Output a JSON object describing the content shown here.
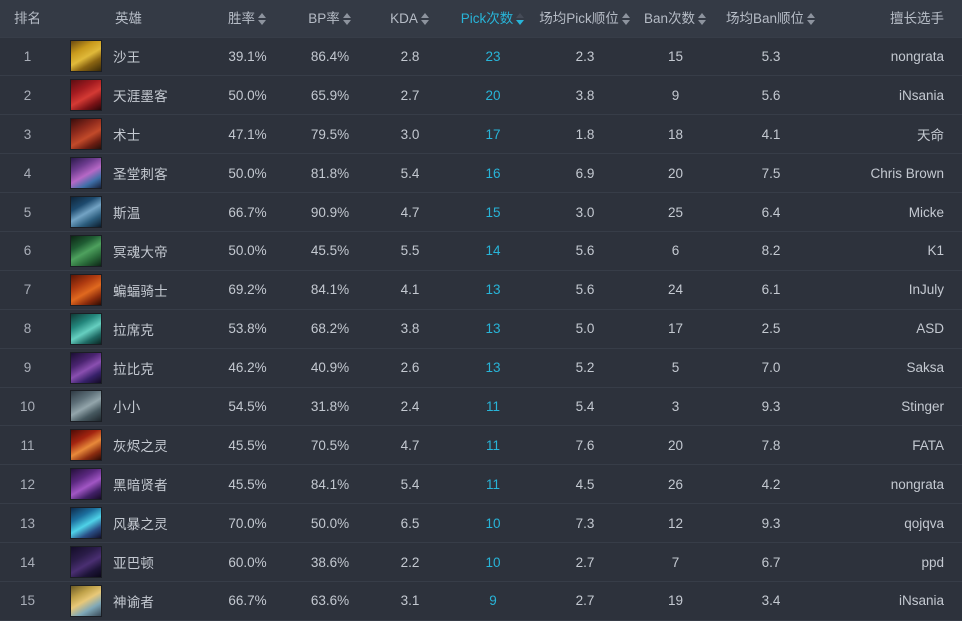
{
  "table": {
    "columns": [
      {
        "key": "rank",
        "label": "排名",
        "sortable": false,
        "active": false
      },
      {
        "key": "hero",
        "label": "英雄",
        "sortable": false,
        "active": false
      },
      {
        "key": "winrate",
        "label": "胜率",
        "sortable": true,
        "active": false
      },
      {
        "key": "bprate",
        "label": "BP率",
        "sortable": true,
        "active": false
      },
      {
        "key": "kda",
        "label": "KDA",
        "sortable": true,
        "active": false
      },
      {
        "key": "pickcnt",
        "label": "Pick次数",
        "sortable": true,
        "active": true
      },
      {
        "key": "avgpick",
        "label": "场均Pick顺位",
        "sortable": true,
        "active": false
      },
      {
        "key": "bancnt",
        "label": "Ban次数",
        "sortable": true,
        "active": false
      },
      {
        "key": "avgban",
        "label": "场均Ban顺位",
        "sortable": true,
        "active": false
      },
      {
        "key": "player",
        "label": "擅长选手",
        "sortable": false,
        "active": false
      }
    ],
    "sort": {
      "column": "pickcnt",
      "direction": "desc"
    },
    "colors": {
      "accent": "#28b4d8",
      "header_bg": "#343a45",
      "row_bg": "#2d323c",
      "row_border": "#373d48",
      "text": "#c4c9d1",
      "header_text": "#b6bcc6"
    },
    "rows": [
      {
        "rank": "1",
        "hero": "沙王",
        "hero_icon": "hero-portrait-sand-king",
        "portrait": "linear-gradient(150deg,#6b4a10 0%,#c99a1c 30%,#e0b93a 52%,#8a6412 72%,#3a2a07 100%)",
        "winrate": "39.1%",
        "bprate": "86.4%",
        "kda": "2.8",
        "pickcnt": "23",
        "avgpick": "2.3",
        "bancnt": "15",
        "avgban": "5.3",
        "player": "nongrata"
      },
      {
        "rank": "2",
        "hero": "天涯墨客",
        "hero_icon": "hero-portrait-grimstroke",
        "portrait": "linear-gradient(150deg,#5c0d12 0%,#a31b20 32%,#d43a34 55%,#7a1216 78%,#2a0608 100%)",
        "winrate": "50.0%",
        "bprate": "65.9%",
        "kda": "2.7",
        "pickcnt": "20",
        "avgpick": "3.8",
        "bancnt": "9",
        "avgban": "5.6",
        "player": "iNsania"
      },
      {
        "rank": "3",
        "hero": "术士",
        "hero_icon": "hero-portrait-warlock",
        "portrait": "linear-gradient(150deg,#3a0d0c 0%,#8e2a1c 34%,#c24a2a 58%,#6b1d12 80%,#24100a 100%)",
        "winrate": "47.1%",
        "bprate": "79.5%",
        "kda": "3.0",
        "pickcnt": "17",
        "avgpick": "1.8",
        "bancnt": "18",
        "avgban": "4.1",
        "player": "天命"
      },
      {
        "rank": "4",
        "hero": "圣堂刺客",
        "hero_icon": "hero-portrait-templar-assassin",
        "portrait": "linear-gradient(150deg,#2a1a4a 0%,#6d3c8f 30%,#b668c6 54%,#3f6fa8 76%,#17203a 100%)",
        "winrate": "50.0%",
        "bprate": "81.8%",
        "kda": "5.4",
        "pickcnt": "16",
        "avgpick": "6.9",
        "bancnt": "20",
        "avgban": "7.5",
        "player": "Chris Brown"
      },
      {
        "rank": "5",
        "hero": "斯温",
        "hero_icon": "hero-portrait-sven",
        "portrait": "linear-gradient(150deg,#0e2438 0%,#1d4a6e 30%,#73a3c4 52%,#2d5e7e 74%,#0b1b2a 100%)",
        "winrate": "66.7%",
        "bprate": "90.9%",
        "kda": "4.7",
        "pickcnt": "15",
        "avgpick": "3.0",
        "bancnt": "25",
        "avgban": "6.4",
        "player": "Micke"
      },
      {
        "rank": "6",
        "hero": "冥魂大帝",
        "hero_icon": "hero-portrait-wraith-king",
        "portrait": "linear-gradient(150deg,#0c2414 0%,#1f5c33 30%,#4ea15e 52%,#2a6b3a 74%,#0d2416 100%)",
        "winrate": "50.0%",
        "bprate": "45.5%",
        "kda": "5.5",
        "pickcnt": "14",
        "avgpick": "5.6",
        "bancnt": "6",
        "avgban": "8.2",
        "player": "K1"
      },
      {
        "rank": "7",
        "hero": "蝙蝠骑士",
        "hero_icon": "hero-portrait-batrider",
        "portrait": "linear-gradient(150deg,#5a1506 0%,#ae3a10 32%,#e0691f 56%,#8c2c0c 78%,#2c0b03 100%)",
        "winrate": "69.2%",
        "bprate": "84.1%",
        "kda": "4.1",
        "pickcnt": "13",
        "avgpick": "5.6",
        "bancnt": "24",
        "avgban": "6.1",
        "player": "InJuly"
      },
      {
        "rank": "8",
        "hero": "拉席克",
        "hero_icon": "hero-portrait-leshrac",
        "portrait": "linear-gradient(150deg,#0f3a36 0%,#23867c 32%,#66cfc0 56%,#1f6a64 78%,#0b2522 100%)",
        "winrate": "53.8%",
        "bprate": "68.2%",
        "kda": "3.8",
        "pickcnt": "13",
        "avgpick": "5.0",
        "bancnt": "17",
        "avgban": "2.5",
        "player": "ASD"
      },
      {
        "rank": "9",
        "hero": "拉比克",
        "hero_icon": "hero-portrait-rubick",
        "portrait": "linear-gradient(150deg,#1b0f33 0%,#4a2470 32%,#8a4fb0 54%,#37216a 76%,#120a22 100%)",
        "winrate": "46.2%",
        "bprate": "40.9%",
        "kda": "2.6",
        "pickcnt": "13",
        "avgpick": "5.2",
        "bancnt": "5",
        "avgban": "7.0",
        "player": "Saksa"
      },
      {
        "rank": "10",
        "hero": "小小",
        "hero_icon": "hero-portrait-tiny",
        "portrait": "linear-gradient(150deg,#2f3a44 0%,#5d6f78 30%,#93a5ab 52%,#46585f 74%,#1e262c 100%)",
        "winrate": "54.5%",
        "bprate": "31.8%",
        "kda": "2.4",
        "pickcnt": "11",
        "avgpick": "5.4",
        "bancnt": "3",
        "avgban": "9.3",
        "player": "Stinger"
      },
      {
        "rank": "11",
        "hero": "灰烬之灵",
        "hero_icon": "hero-portrait-ember-spirit",
        "portrait": "linear-gradient(150deg,#4d0b06 0%,#a32410 32%,#e8893a 56%,#8a2c10 78%,#2a0a04 100%)",
        "winrate": "45.5%",
        "bprate": "70.5%",
        "kda": "4.7",
        "pickcnt": "11",
        "avgpick": "7.6",
        "bancnt": "20",
        "avgban": "7.8",
        "player": "FATA"
      },
      {
        "rank": "12",
        "hero": "黑暗贤者",
        "hero_icon": "hero-portrait-dark-seer",
        "portrait": "linear-gradient(150deg,#24103a 0%,#5b2880 32%,#a156c4 56%,#412066 78%,#170b26 100%)",
        "winrate": "45.5%",
        "bprate": "84.1%",
        "kda": "5.4",
        "pickcnt": "11",
        "avgpick": "4.5",
        "bancnt": "26",
        "avgban": "4.2",
        "player": "nongrata"
      },
      {
        "rank": "13",
        "hero": "风暴之灵",
        "hero_icon": "hero-portrait-storm-spirit",
        "portrait": "linear-gradient(150deg,#0e2a4a 0%,#1c6f9e 30%,#4fd2e8 54%,#2a4f86 76%,#120f2a 100%)",
        "winrate": "70.0%",
        "bprate": "50.0%",
        "kda": "6.5",
        "pickcnt": "10",
        "avgpick": "7.3",
        "bancnt": "12",
        "avgban": "9.3",
        "player": "qojqva"
      },
      {
        "rank": "14",
        "hero": "亚巴顿",
        "hero_icon": "hero-portrait-abaddon",
        "portrait": "linear-gradient(150deg,#140d28 0%,#2a1c48 32%,#4a2f72 56%,#1d1438 78%,#0b0718 100%)",
        "winrate": "60.0%",
        "bprate": "38.6%",
        "kda": "2.2",
        "pickcnt": "10",
        "avgpick": "2.7",
        "bancnt": "7",
        "avgban": "6.7",
        "player": "ppd"
      },
      {
        "rank": "15",
        "hero": "神谕者",
        "hero_icon": "hero-portrait-oracle",
        "portrait": "linear-gradient(150deg,#6b5a24 0%,#c0a24a 28%,#e8c878 48%,#7fa8b8 72%,#3a4a58 100%)",
        "winrate": "66.7%",
        "bprate": "63.6%",
        "kda": "3.1",
        "pickcnt": "9",
        "avgpick": "2.7",
        "bancnt": "19",
        "avgban": "3.4",
        "player": "iNsania"
      }
    ]
  }
}
